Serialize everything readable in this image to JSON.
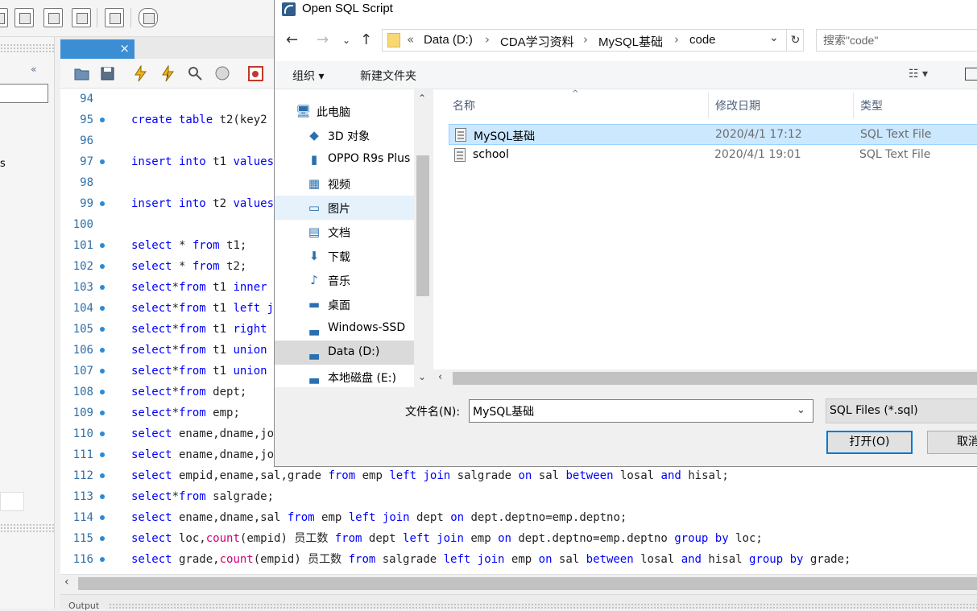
{
  "editor": {
    "tab_close": "×",
    "lines": [
      {
        "n": "94",
        "bullet": false,
        "parts": []
      },
      {
        "n": "95",
        "bullet": true,
        "parts": [
          {
            "t": "create table ",
            "k": "kw"
          },
          {
            "t": "t2(key2",
            "k": ""
          }
        ]
      },
      {
        "n": "96",
        "bullet": false,
        "parts": []
      },
      {
        "n": "97",
        "bullet": true,
        "parts": [
          {
            "t": "insert into ",
            "k": "kw"
          },
          {
            "t": "t1 ",
            "k": ""
          },
          {
            "t": "values",
            "k": "kw"
          }
        ]
      },
      {
        "n": "98",
        "bullet": false,
        "parts": []
      },
      {
        "n": "99",
        "bullet": true,
        "parts": [
          {
            "t": "insert into ",
            "k": "kw"
          },
          {
            "t": "t2 ",
            "k": ""
          },
          {
            "t": "values",
            "k": "kw"
          }
        ]
      },
      {
        "n": "100",
        "bullet": false,
        "parts": []
      },
      {
        "n": "101",
        "bullet": true,
        "parts": [
          {
            "t": "select",
            "k": "kw"
          },
          {
            "t": " * ",
            "k": ""
          },
          {
            "t": "from",
            "k": "kw"
          },
          {
            "t": " t1;",
            "k": ""
          }
        ]
      },
      {
        "n": "102",
        "bullet": true,
        "parts": [
          {
            "t": "select",
            "k": "kw"
          },
          {
            "t": " * ",
            "k": ""
          },
          {
            "t": "from",
            "k": "kw"
          },
          {
            "t": " t2;",
            "k": ""
          }
        ]
      },
      {
        "n": "103",
        "bullet": true,
        "parts": [
          {
            "t": "select",
            "k": "kw"
          },
          {
            "t": "*",
            "k": ""
          },
          {
            "t": "from",
            "k": "kw"
          },
          {
            "t": " t1 ",
            "k": ""
          },
          {
            "t": "inner",
            "k": "kw"
          }
        ]
      },
      {
        "n": "104",
        "bullet": true,
        "parts": [
          {
            "t": "select",
            "k": "kw"
          },
          {
            "t": "*",
            "k": ""
          },
          {
            "t": "from",
            "k": "kw"
          },
          {
            "t": " t1 ",
            "k": ""
          },
          {
            "t": "left j",
            "k": "kw"
          }
        ]
      },
      {
        "n": "105",
        "bullet": true,
        "parts": [
          {
            "t": "select",
            "k": "kw"
          },
          {
            "t": "*",
            "k": ""
          },
          {
            "t": "from",
            "k": "kw"
          },
          {
            "t": " t1 ",
            "k": ""
          },
          {
            "t": "right",
            "k": "kw"
          }
        ]
      },
      {
        "n": "106",
        "bullet": true,
        "parts": [
          {
            "t": "select",
            "k": "kw"
          },
          {
            "t": "*",
            "k": ""
          },
          {
            "t": "from",
            "k": "kw"
          },
          {
            "t": " t1 ",
            "k": ""
          },
          {
            "t": "union",
            "k": "kw"
          }
        ]
      },
      {
        "n": "107",
        "bullet": true,
        "parts": [
          {
            "t": "select",
            "k": "kw"
          },
          {
            "t": "*",
            "k": ""
          },
          {
            "t": "from",
            "k": "kw"
          },
          {
            "t": " t1 ",
            "k": ""
          },
          {
            "t": "union",
            "k": "kw"
          }
        ]
      },
      {
        "n": "108",
        "bullet": true,
        "parts": [
          {
            "t": "select",
            "k": "kw"
          },
          {
            "t": "*",
            "k": ""
          },
          {
            "t": "from",
            "k": "kw"
          },
          {
            "t": " dept;",
            "k": ""
          }
        ]
      },
      {
        "n": "109",
        "bullet": true,
        "parts": [
          {
            "t": "select",
            "k": "kw"
          },
          {
            "t": "*",
            "k": ""
          },
          {
            "t": "from",
            "k": "kw"
          },
          {
            "t": " emp;",
            "k": ""
          }
        ]
      },
      {
        "n": "110",
        "bullet": true,
        "parts": [
          {
            "t": "select",
            "k": "kw"
          },
          {
            "t": " ename,dname,jo",
            "k": ""
          }
        ]
      },
      {
        "n": "111",
        "bullet": true,
        "parts": [
          {
            "t": "select",
            "k": "kw"
          },
          {
            "t": " ename,dname,jo",
            "k": ""
          }
        ]
      },
      {
        "n": "112",
        "bullet": true,
        "parts": [
          {
            "t": "select",
            "k": "kw"
          },
          {
            "t": " empid,ename,sal,grade ",
            "k": ""
          },
          {
            "t": "from",
            "k": "kw"
          },
          {
            "t": " emp ",
            "k": ""
          },
          {
            "t": "left join",
            "k": "kw"
          },
          {
            "t": " salgrade ",
            "k": ""
          },
          {
            "t": "on",
            "k": "kw"
          },
          {
            "t": " sal ",
            "k": ""
          },
          {
            "t": "between",
            "k": "kw"
          },
          {
            "t": " losal ",
            "k": ""
          },
          {
            "t": "and",
            "k": "kw"
          },
          {
            "t": " hisal;",
            "k": ""
          }
        ]
      },
      {
        "n": "113",
        "bullet": true,
        "parts": [
          {
            "t": "select",
            "k": "kw"
          },
          {
            "t": "*",
            "k": ""
          },
          {
            "t": "from",
            "k": "kw"
          },
          {
            "t": " salgrade;",
            "k": ""
          }
        ]
      },
      {
        "n": "114",
        "bullet": true,
        "parts": [
          {
            "t": "select",
            "k": "kw"
          },
          {
            "t": " ename,dname,sal ",
            "k": ""
          },
          {
            "t": "from",
            "k": "kw"
          },
          {
            "t": " emp ",
            "k": ""
          },
          {
            "t": "left join",
            "k": "kw"
          },
          {
            "t": " dept ",
            "k": ""
          },
          {
            "t": "on",
            "k": "kw"
          },
          {
            "t": " dept.deptno=emp.deptno;",
            "k": ""
          }
        ]
      },
      {
        "n": "115",
        "bullet": true,
        "parts": [
          {
            "t": "select",
            "k": "kw"
          },
          {
            "t": " loc,",
            "k": ""
          },
          {
            "t": "count",
            "k": "fn"
          },
          {
            "t": "(empid) 员工数 ",
            "k": ""
          },
          {
            "t": "from",
            "k": "kw"
          },
          {
            "t": " dept ",
            "k": ""
          },
          {
            "t": "left join",
            "k": "kw"
          },
          {
            "t": " emp ",
            "k": ""
          },
          {
            "t": "on",
            "k": "kw"
          },
          {
            "t": " dept.deptno=emp.deptno ",
            "k": ""
          },
          {
            "t": "group by",
            "k": "kw"
          },
          {
            "t": " loc;",
            "k": ""
          }
        ]
      },
      {
        "n": "116",
        "bullet": true,
        "parts": [
          {
            "t": "select",
            "k": "kw"
          },
          {
            "t": " grade,",
            "k": ""
          },
          {
            "t": "count",
            "k": "fn"
          },
          {
            "t": "(empid) 员工数 ",
            "k": ""
          },
          {
            "t": "from",
            "k": "kw"
          },
          {
            "t": " salgrade ",
            "k": ""
          },
          {
            "t": "left join",
            "k": "kw"
          },
          {
            "t": " emp ",
            "k": ""
          },
          {
            "t": "on",
            "k": "kw"
          },
          {
            "t": " sal ",
            "k": ""
          },
          {
            "t": "between",
            "k": "kw"
          },
          {
            "t": " losal ",
            "k": ""
          },
          {
            "t": "and",
            "k": "kw"
          },
          {
            "t": " hisal ",
            "k": ""
          },
          {
            "t": "group by",
            "k": "kw"
          },
          {
            "t": " grade;",
            "k": ""
          }
        ]
      }
    ]
  },
  "left_panel": {
    "back_glyph": "«",
    "partial_text": "s"
  },
  "output": {
    "label": "Output"
  },
  "dialog": {
    "title": "Open SQL Script",
    "address": {
      "prefix": "«",
      "crumbs": [
        "Data (D:)",
        "CDA学习资料",
        "MySQL基础",
        "code"
      ],
      "separator": "›"
    },
    "search_placeholder": "搜索\"code\"",
    "commands": {
      "organize": "组织 ▾",
      "new_folder": "新建文件夹",
      "view": "☷ ▾"
    },
    "nav_items": [
      {
        "label": "此电脑",
        "icon": "computer-icon",
        "glyph": "🖥",
        "state": "",
        "indent": 26
      },
      {
        "label": "3D 对象",
        "icon": "3d-objects-icon",
        "glyph": "◆",
        "state": "",
        "indent": 40
      },
      {
        "label": "OPPO R9s Plus",
        "icon": "phone-icon",
        "glyph": "▮",
        "state": "",
        "indent": 40
      },
      {
        "label": "视频",
        "icon": "video-icon",
        "glyph": "▦",
        "state": "",
        "indent": 40
      },
      {
        "label": "图片",
        "icon": "pictures-icon",
        "glyph": "▭",
        "state": "hover",
        "indent": 40
      },
      {
        "label": "文档",
        "icon": "documents-icon",
        "glyph": "▤",
        "state": "",
        "indent": 40
      },
      {
        "label": "下载",
        "icon": "download-icon",
        "glyph": "⬇",
        "state": "",
        "indent": 40
      },
      {
        "label": "音乐",
        "icon": "music-icon",
        "glyph": "♪",
        "state": "",
        "indent": 40
      },
      {
        "label": "桌面",
        "icon": "desktop-icon",
        "glyph": "▬",
        "state": "",
        "indent": 40
      },
      {
        "label": "Windows-SSD",
        "icon": "drive-icon",
        "glyph": "▃",
        "state": "",
        "indent": 40
      },
      {
        "label": "Data (D:)",
        "icon": "drive-icon",
        "glyph": "▃",
        "state": "selected",
        "indent": 40
      },
      {
        "label": "本地磁盘 (E:)",
        "icon": "drive-icon",
        "glyph": "▃",
        "state": "",
        "indent": 40
      }
    ],
    "columns": {
      "name": "名称",
      "date": "修改日期",
      "type": "类型"
    },
    "files": [
      {
        "name": "MySQL基础",
        "date": "2020/4/1 17:12",
        "type": "SQL Text File",
        "selected": true
      },
      {
        "name": "school",
        "date": "2020/4/1 19:01",
        "type": "SQL Text File",
        "selected": false
      }
    ],
    "filename_label": "文件名(N):",
    "filename_value": "MySQL基础",
    "filter": "SQL Files (*.sql)",
    "open_label": "打开(O)",
    "cancel_label": "取消",
    "colors": {
      "selection": "#cce8ff",
      "accent": "#0078d7",
      "keyword": "#0000ff"
    }
  }
}
